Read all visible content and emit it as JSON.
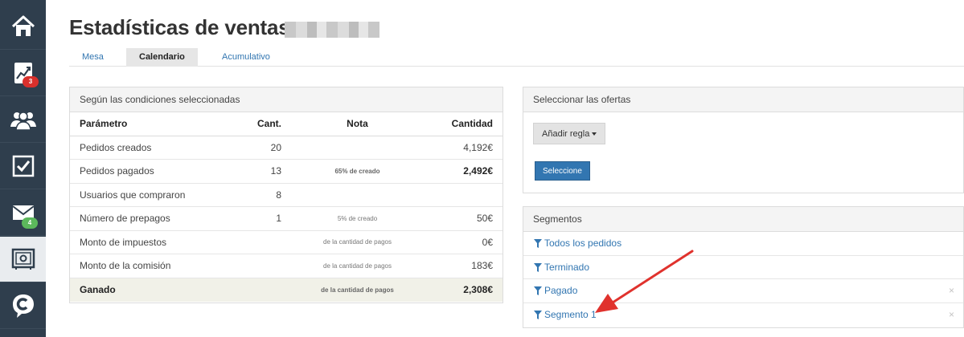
{
  "page": {
    "title": "Estadísticas de ventas:"
  },
  "sidebar": {
    "items": [
      {
        "icon": "home-icon"
      },
      {
        "icon": "chart-icon",
        "badge": "3"
      },
      {
        "icon": "users-icon"
      },
      {
        "icon": "checkbox-icon"
      },
      {
        "icon": "mail-icon",
        "badge": "4"
      },
      {
        "icon": "safe-icon"
      },
      {
        "icon": "chat-logo-icon"
      }
    ]
  },
  "tabs": [
    {
      "label": "Mesa"
    },
    {
      "label": "Calendario"
    },
    {
      "label": "Acumulativo"
    }
  ],
  "stats_panel": {
    "heading": "Según las condiciones seleccionadas",
    "columns": [
      "Parámetro",
      "Cant.",
      "Nota",
      "Cantidad"
    ],
    "rows": [
      {
        "param": "Pedidos creados",
        "count": "20",
        "note": "",
        "amount": "4,192€"
      },
      {
        "param": "Pedidos pagados",
        "count": "13",
        "note": "65% de creado",
        "amount": "2,492€"
      },
      {
        "param": "Usuarios que compraron",
        "count": "8",
        "note": "",
        "amount": ""
      },
      {
        "param": "Número de prepagos",
        "count": "1",
        "note": "5% de creado",
        "amount": "50€"
      },
      {
        "param": "Monto de impuestos",
        "count": "",
        "note": "de la cantidad de pagos",
        "amount": "0€"
      },
      {
        "param": "Monto de la comisión",
        "count": "",
        "note": "de la cantidad de pagos",
        "amount": "183€"
      }
    ],
    "total": {
      "param": "Ganado",
      "note": "de la cantidad de pagos",
      "amount": "2,308€"
    }
  },
  "offers_panel": {
    "heading": "Seleccionar las ofertas",
    "add_rule_label": "Añadir regla",
    "select_label": "Seleccione"
  },
  "segments_panel": {
    "heading": "Segmentos",
    "items": [
      {
        "label": "Todos los pedidos"
      },
      {
        "label": "Terminado"
      },
      {
        "label": "Pagado",
        "remove": "×"
      },
      {
        "label": "Segmento 1",
        "remove": "×"
      }
    ]
  },
  "colors": {
    "sidebar": "#2f3e4d",
    "link": "#3276b1",
    "primary_button": "#3276b1",
    "badge_red": "#d9302c",
    "badge_green": "#5cb85c",
    "annotation_arrow": "#e0322d"
  }
}
